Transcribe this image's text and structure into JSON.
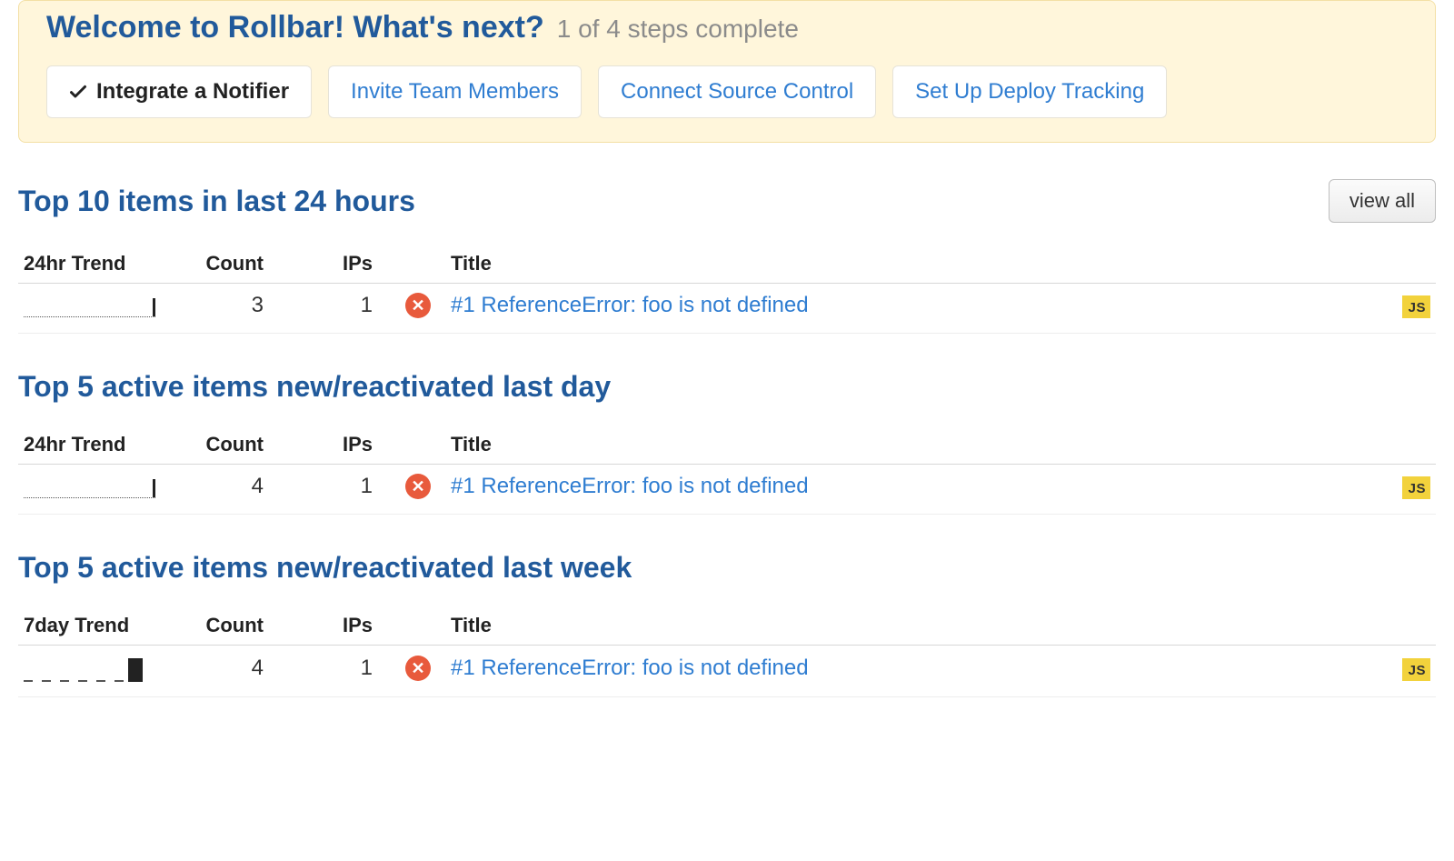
{
  "onboarding": {
    "title": "Welcome to Rollbar! What's next?",
    "progress": "1 of 4 steps complete",
    "steps": [
      {
        "label": "Integrate a Notifier",
        "done": true
      },
      {
        "label": "Invite Team Members",
        "done": false
      },
      {
        "label": "Connect Source Control",
        "done": false
      },
      {
        "label": "Set Up Deploy Tracking",
        "done": false
      }
    ]
  },
  "view_all_label": "view all",
  "columns": {
    "trend24": "24hr Trend",
    "trend7": "7day Trend",
    "count": "Count",
    "ips": "IPs",
    "title": "Title"
  },
  "lang_badge": "JS",
  "sections": [
    {
      "title": "Top 10 items in last 24 hours",
      "trend": "24hr",
      "show_view_all": true,
      "rows": [
        {
          "count": 3,
          "ips": 1,
          "level": "error",
          "title": "#1 ReferenceError: foo is not defined",
          "lang": "JS"
        }
      ]
    },
    {
      "title": "Top 5 active items new/reactivated last day",
      "trend": "24hr",
      "show_view_all": false,
      "rows": [
        {
          "count": 4,
          "ips": 1,
          "level": "error",
          "title": "#1 ReferenceError: foo is not defined",
          "lang": "JS"
        }
      ]
    },
    {
      "title": "Top 5 active items new/reactivated last week",
      "trend": "7day",
      "show_view_all": false,
      "rows": [
        {
          "count": 4,
          "ips": 1,
          "level": "error",
          "title": "#1 ReferenceError: foo is not defined",
          "lang": "JS"
        }
      ]
    }
  ]
}
